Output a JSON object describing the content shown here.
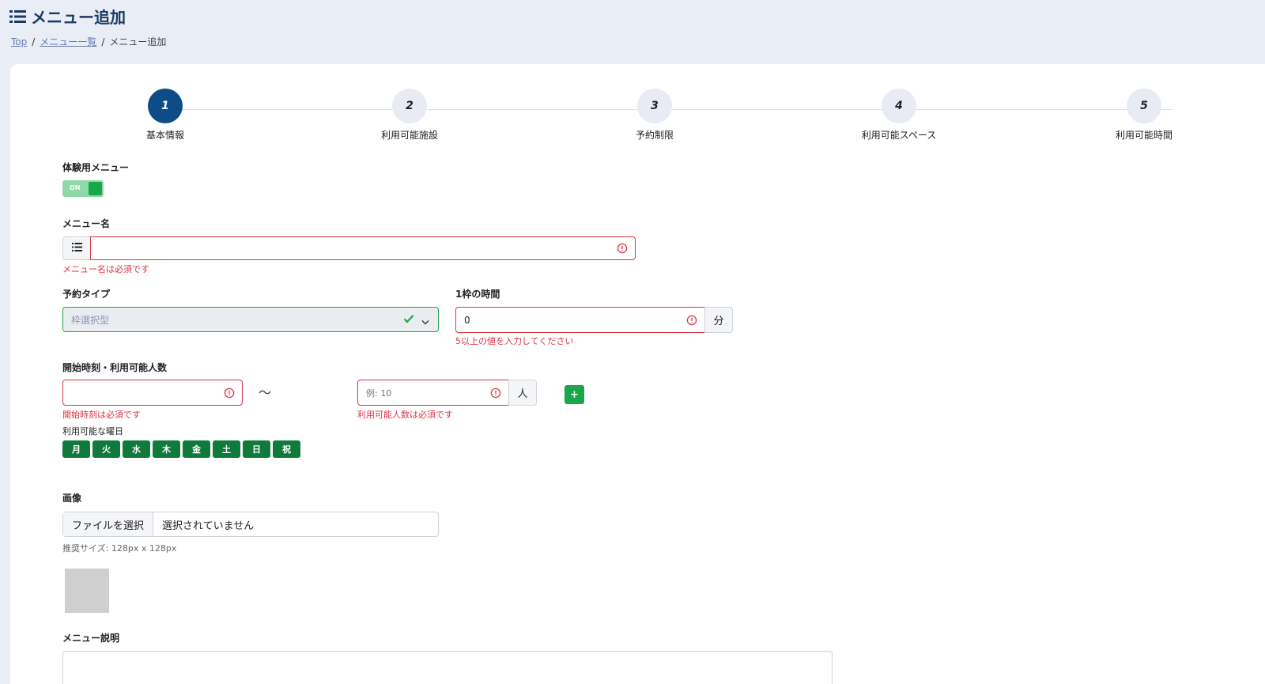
{
  "header": {
    "title": "メニュー追加",
    "breadcrumb": {
      "top": "Top",
      "menu_list": "メニュー一覧",
      "current": "メニュー追加",
      "sep": "/"
    }
  },
  "steps": [
    {
      "num": "1",
      "label": "基本情報"
    },
    {
      "num": "2",
      "label": "利用可能施設"
    },
    {
      "num": "3",
      "label": "予約制限"
    },
    {
      "num": "4",
      "label": "利用可能スペース"
    },
    {
      "num": "5",
      "label": "利用可能時間"
    }
  ],
  "trial": {
    "label": "体験用メニュー",
    "toggle_text": "ON"
  },
  "menu_name": {
    "label": "メニュー名",
    "value": "",
    "error": "メニュー名は必須です"
  },
  "reservation_type": {
    "label": "予約タイプ",
    "value": "枠選択型"
  },
  "slot_time": {
    "label": "1枠の時間",
    "value": "0",
    "unit": "分",
    "error": "5以上の値を入力してください"
  },
  "start_time": {
    "label": "開始時刻・利用可能人数",
    "value": "",
    "error": "開始時刻は必須です",
    "tilde": "〜",
    "capacity_placeholder": "例: 10",
    "capacity_unit": "人",
    "capacity_error": "利用可能人数は必須です",
    "add_label": "+"
  },
  "weekdays": {
    "label": "利用可能な曜日",
    "days": [
      "月",
      "火",
      "水",
      "木",
      "金",
      "土",
      "日",
      "祝"
    ]
  },
  "image": {
    "label": "画像",
    "button": "ファイルを選択",
    "filename": "選択されていません",
    "hint": "推奨サイズ: 128px x 128px"
  },
  "description": {
    "label": "メニュー説明",
    "value": ""
  },
  "colors": {
    "primary": "#0d4c86",
    "success": "#1aa64b",
    "day_green": "#0f7a3c",
    "error": "#dc3545"
  }
}
